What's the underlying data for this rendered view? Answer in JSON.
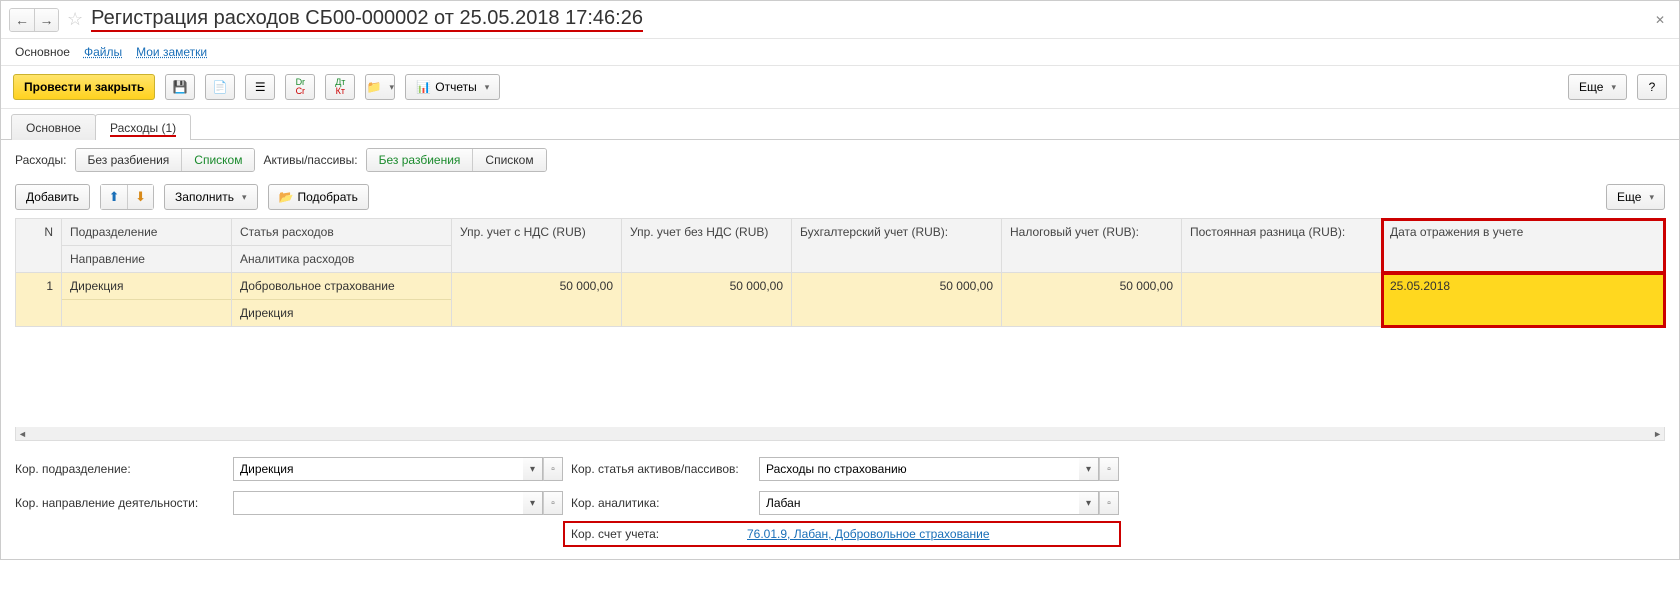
{
  "header": {
    "title": "Регистрация расходов СБ00-000002 от 25.05.2018 17:46:26"
  },
  "nav_tabs": {
    "main": "Основное",
    "files": "Файлы",
    "notes": "Мои заметки"
  },
  "toolbar": {
    "post_and_close": "Провести и закрыть",
    "reports": "Отчеты",
    "more": "Еще",
    "help": "?"
  },
  "inner_tabs": {
    "main": "Основное",
    "expenses": "Расходы (1)"
  },
  "filters": {
    "expenses_label": "Расходы:",
    "no_split": "Без разбиения",
    "as_list": "Списком",
    "assets_label": "Активы/пассивы:"
  },
  "actions": {
    "add": "Добавить",
    "fill": "Заполнить",
    "pick": "Подобрать",
    "more": "Еще"
  },
  "table": {
    "headers": {
      "n": "N",
      "division": "Подразделение",
      "direction": "Направление",
      "expense_item": "Статья расходов",
      "expense_analytics": "Аналитика расходов",
      "mgr_vat": "Упр. учет с НДС (RUB)",
      "mgr_novat": "Упр. учет без НДС (RUB)",
      "book": "Бухгалтерский учет (RUB):",
      "tax": "Налоговый учет (RUB):",
      "perm_diff": "Постоянная разница (RUB):",
      "reflect_date": "Дата отражения в учете"
    },
    "rows": [
      {
        "n": "1",
        "division": "Дирекция",
        "direction": "",
        "expense_item": "Добровольное страхование",
        "expense_analytics": "Дирекция",
        "mgr_vat": "50 000,00",
        "mgr_novat": "50 000,00",
        "book": "50 000,00",
        "tax": "50 000,00",
        "perm_diff": "",
        "reflect_date": "25.05.2018"
      }
    ]
  },
  "form": {
    "corr_division_label": "Кор. подразделение:",
    "corr_division_value": "Дирекция",
    "corr_article_label": "Кор. статья активов/пассивов:",
    "corr_article_value": "Расходы по страхованию",
    "corr_direction_label": "Кор. направление деятельности:",
    "corr_direction_value": "",
    "corr_analytics_label": "Кор. аналитика:",
    "corr_analytics_value": "Лабан",
    "corr_account_label": "Кор. счет учета:",
    "corr_account_value": "76.01.9, Лабан, Добровольное страхование"
  }
}
